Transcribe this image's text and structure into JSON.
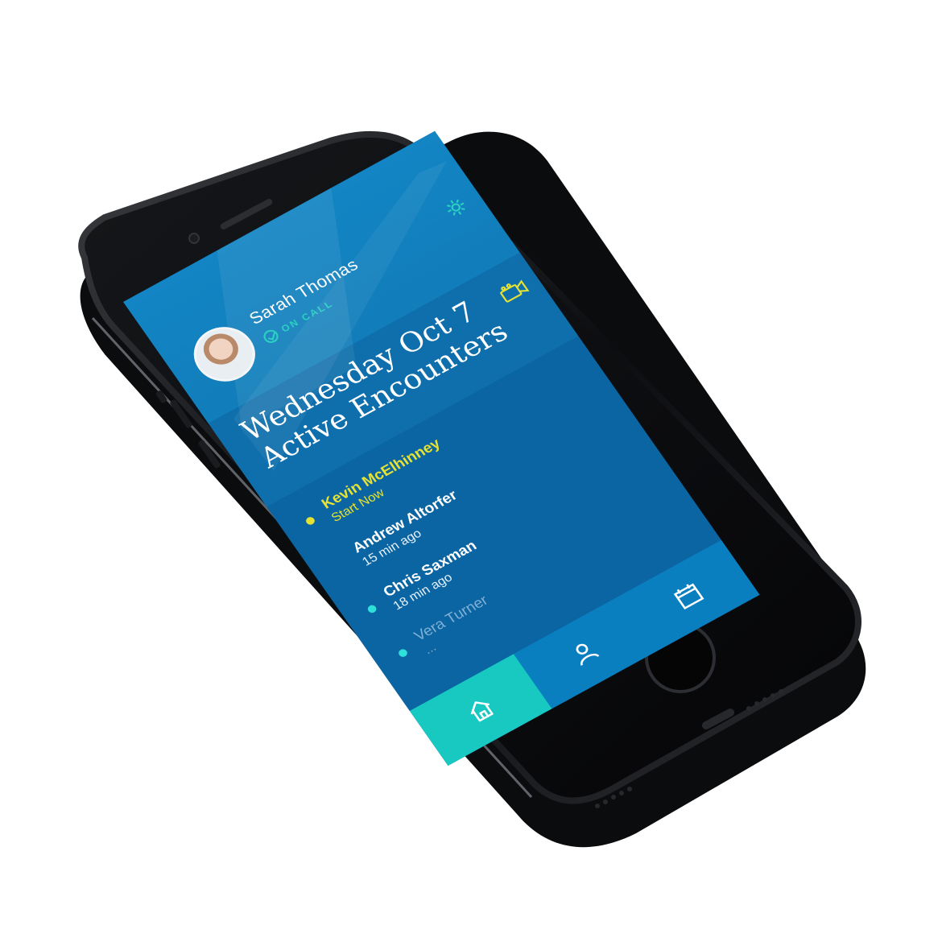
{
  "header": {
    "user_name": "Sarah Thomas",
    "status": "ON CALL",
    "settings_icon": "gear-icon"
  },
  "date_section": {
    "date": "Wednesday Oct 7",
    "title": "Active Encounters",
    "video_icon": "video-camera-icon"
  },
  "encounters": [
    {
      "name": "Kevin McElhinney",
      "sub": "Start Now",
      "dot": true,
      "color": "#e6e233",
      "sub_color": "#e6e233"
    },
    {
      "name": "Andrew Altorfer",
      "sub": "15 min ago",
      "dot": false,
      "color": "#ffffff",
      "sub_color": "#e7f1f9"
    },
    {
      "name": "Chris Saxman",
      "sub": "18 min ago",
      "dot": true,
      "color": "#ffffff",
      "sub_color": "#e7f1f9"
    },
    {
      "name": "Vera Turner",
      "sub": "...",
      "dot": true,
      "color": "#7fb0d6",
      "sub_color": "#7fb0d6"
    }
  ],
  "dot_color": "#2ee0da",
  "nav": {
    "tabs": [
      {
        "icon": "home-icon",
        "active": true
      },
      {
        "icon": "user-icon",
        "active": false
      },
      {
        "icon": "calendar-icon",
        "active": false
      }
    ]
  },
  "colors": {
    "accent": "#17c9c0",
    "header": "#1385c4",
    "body": "#0b65a2",
    "highlight": "#e6e233"
  }
}
